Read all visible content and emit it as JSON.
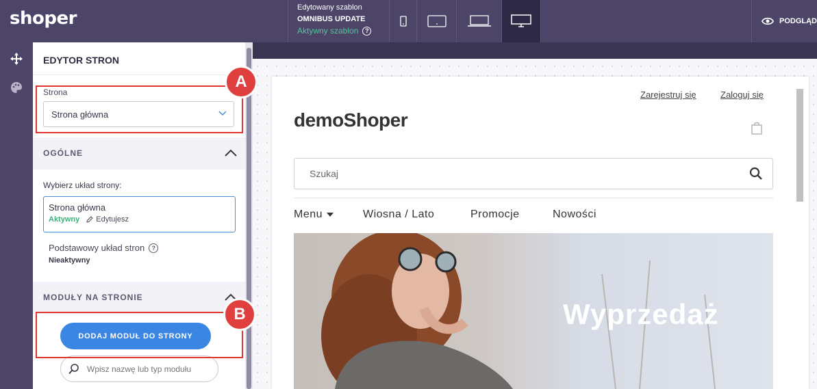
{
  "topbar": {
    "logo": "shoper",
    "template_label": "Edytowany szablon",
    "template_name": "OMNIBUS UPDATE",
    "template_status": "Aktywny szablon",
    "preview_label": "PODGLĄD",
    "devices": [
      "phone-icon",
      "tablet-icon",
      "laptop-icon",
      "desktop-icon"
    ],
    "active_device": "desktop"
  },
  "iconstrip": {
    "icons": [
      "move-icon",
      "palette-icon"
    ]
  },
  "panel": {
    "title": "EDYTOR STRON",
    "page_label": "Strona",
    "page_select": "Strona główna",
    "general": {
      "title": "OGÓLNE",
      "choose_layout": "Wybierz układ strony:",
      "layouts": [
        {
          "name": "Strona główna",
          "status": "Aktywny",
          "edit": "Edytujesz"
        },
        {
          "name": "Podstawowy układ stron",
          "status": "Nieaktywny"
        }
      ]
    },
    "modules": {
      "title": "MODUŁY NA STRONIE",
      "add_button": "DODAJ MODUŁ DO STRONY",
      "search_placeholder": "Wpisz nazwę lub typ modułu"
    }
  },
  "annotations": [
    "A",
    "B"
  ],
  "shop": {
    "register": "Zarejestruj się",
    "login": "Zaloguj się",
    "logo": "demoShoper",
    "search_placeholder": "Szukaj",
    "nav": [
      "Menu",
      "Wiosna / Lato",
      "Promocje",
      "Nowości"
    ],
    "hero_text": "Wyprzedaż"
  },
  "colors": {
    "topbar": "#4d4568",
    "accent_blue": "#3b86e3",
    "active_green": "#3fae7a",
    "highlight_red": "#e3342f"
  }
}
